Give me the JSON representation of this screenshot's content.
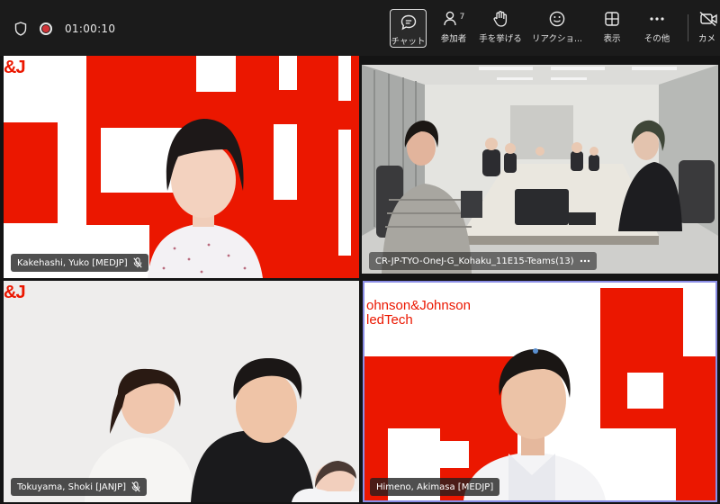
{
  "meeting": {
    "timer": "01:00:10",
    "participant_count": "7"
  },
  "toolbar": {
    "chat_label": "チャット",
    "people_label": "参加者",
    "raise_hand_label": "手を挙げる",
    "reactions_label": "リアクショ...",
    "view_label": "表示",
    "more_label": "その他",
    "camera_label": "カメ"
  },
  "tiles": [
    {
      "name": "Kakehashi, Yuko [MEDJP]",
      "brand": "&J"
    },
    {
      "name": "CR-JP-TYO-OneJ-G_Kohaku_11E15-Teams(13)"
    },
    {
      "name": "Tokuyama, Shoki [JANJP]",
      "brand": "&J"
    },
    {
      "name": "Himeno, Akimasa [MEDJP]",
      "brand_line1": "ohnson&Johnson",
      "brand_line2": "ledTech"
    }
  ],
  "colors": {
    "brand_red": "#eb1700",
    "active_speaker_border": "#8b8ee6",
    "recording": "#d13438"
  },
  "icons": {
    "shield": "shield-icon",
    "record": "record-icon",
    "chat": "chat-icon",
    "people": "people-icon",
    "hand": "hand-icon",
    "smile": "smile-icon",
    "grid": "grid-icon",
    "more": "more-icon",
    "camera_off": "camera-off-icon",
    "mic_off": "mic-off-icon"
  }
}
